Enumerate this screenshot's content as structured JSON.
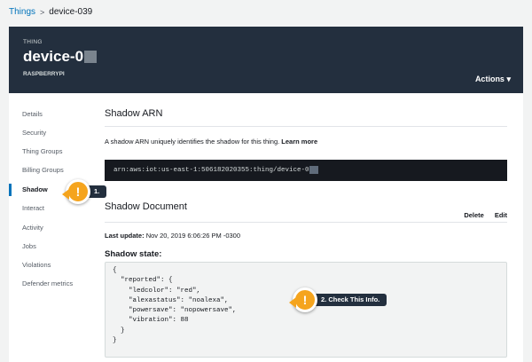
{
  "breadcrumb": {
    "parent": "Things",
    "separator": ">",
    "current": "device-039"
  },
  "header": {
    "kind": "THING",
    "title": "device-0",
    "type": "RASPBERRYPI",
    "actions_label": "Actions",
    "actions_caret": "▾"
  },
  "sidebar": {
    "items": [
      {
        "label": "Details"
      },
      {
        "label": "Security"
      },
      {
        "label": "Thing Groups"
      },
      {
        "label": "Billing Groups"
      },
      {
        "label": "Shadow"
      },
      {
        "label": "Interact"
      },
      {
        "label": "Activity"
      },
      {
        "label": "Jobs"
      },
      {
        "label": "Violations"
      },
      {
        "label": "Defender metrics"
      }
    ]
  },
  "shadow_arn": {
    "title": "Shadow ARN",
    "description": "A shadow ARN uniquely identifies the shadow for this thing.",
    "learn_more": "Learn more",
    "arn": "arn:aws:iot:us-east-1:506182020355:thing/device-0"
  },
  "shadow_document": {
    "title": "Shadow Document",
    "delete_label": "Delete",
    "edit_label": "Edit",
    "last_update_label": "Last update:",
    "last_update_value": "Nov 20, 2019 6:06:26 PM -0300",
    "state_label": "Shadow state:",
    "code_lines": [
      "{",
      "  \"reported\": {",
      "    \"ledcolor\": \"red\",",
      "    \"alexastatus\": \"noalexa\",",
      "    \"powersave\": \"nopowersave\",",
      "    \"vibration\": 88",
      "  }",
      "}"
    ]
  },
  "callouts": {
    "first": {
      "icon": "!",
      "label": "1."
    },
    "second": {
      "icon": "!",
      "label": "2. Check This Info."
    }
  },
  "colors": {
    "header_bg": "#232f3e",
    "link": "#0073bb",
    "callout": "#f5a41d",
    "active_border": "#0073bb"
  }
}
